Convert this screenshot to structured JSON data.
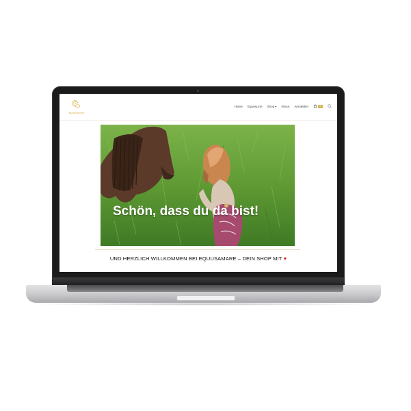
{
  "device": {
    "type": "laptop-mockup"
  },
  "brand": {
    "logo_text": "Equusamare",
    "accent_color": "#d9b24a",
    "icon": "logo-icon"
  },
  "nav": {
    "items": [
      {
        "label": "Home"
      },
      {
        "label": "EquusLine"
      },
      {
        "label": "Shop"
      },
      {
        "label": "About"
      },
      {
        "label": "Anmelden"
      }
    ],
    "cart_count": "0",
    "icons": [
      "shopping-bag-icon",
      "search-icon",
      "chevron-down-icon"
    ]
  },
  "hero": {
    "headline": "Schön, dass du da bist!"
  },
  "welcome": {
    "text": "UND HERZLICH WILLKOMMEN BEI EQUUSAMARE – DEIN SHOP MIT",
    "heart": "♥",
    "heart_color": "#d0202e"
  }
}
